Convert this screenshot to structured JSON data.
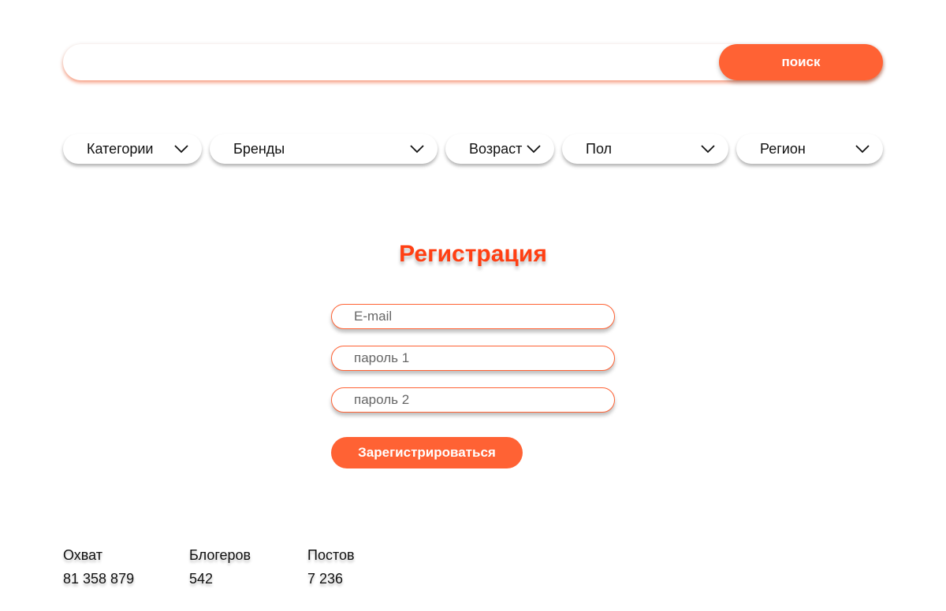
{
  "search": {
    "value": "",
    "placeholder": "",
    "button_label": "поиск"
  },
  "filters": [
    {
      "label": "Категории",
      "icon": "chevron-down-icon"
    },
    {
      "label": "Бренды",
      "icon": "chevron-down-icon"
    },
    {
      "label": "Возраст",
      "icon": "chevron-down-icon"
    },
    {
      "label": "Пол",
      "icon": "chevron-down-icon"
    },
    {
      "label": "Регион",
      "icon": "chevron-down-icon"
    }
  ],
  "registration": {
    "title": "Регистрация",
    "email_placeholder": "E-mail",
    "password1_placeholder": "пароль 1",
    "password2_placeholder": "пароль 2",
    "submit_label": "Зарегистрироваться"
  },
  "stats": [
    {
      "label": "Охват",
      "value": "81 358 879"
    },
    {
      "label": "Блогеров",
      "value": "542"
    },
    {
      "label": "Постов",
      "value": "7 236"
    }
  ],
  "colors": {
    "accent": "#ff6234",
    "title": "#ff3f13",
    "background": "#ffffff",
    "text": "#111111"
  }
}
